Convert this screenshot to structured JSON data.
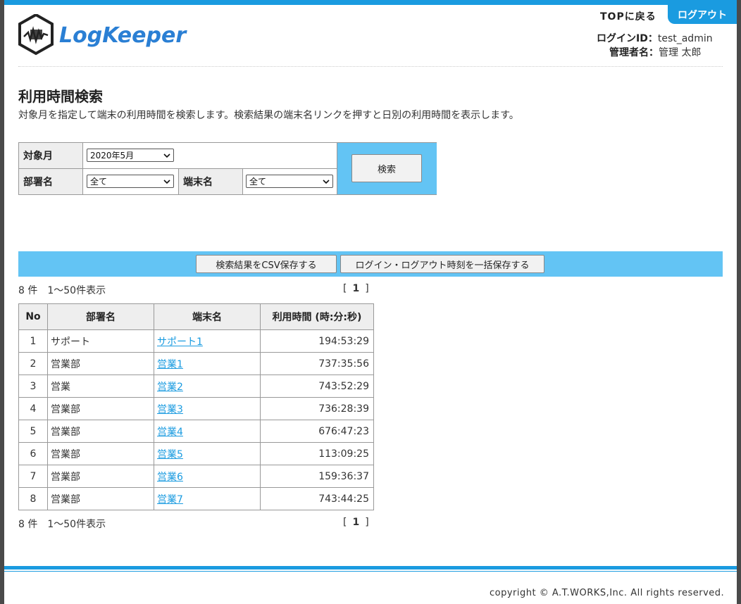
{
  "header": {
    "logo_text": "LogKeeper",
    "top_link": "TOPに戻る",
    "logout_label": "ログアウト",
    "login_id_label": "ログインID：",
    "login_id_value": "test_admin",
    "admin_name_label": "管理者名：",
    "admin_name_value": "管理 太郎"
  },
  "page": {
    "title": "利用時間検索",
    "description": "対象月を指定して端末の利用時間を検索します。検索結果の端末名リンクを押すと日別の利用時間を表示します。"
  },
  "search_form": {
    "month_label": "対象月",
    "month_value": "2020年5月",
    "dept_label": "部署名",
    "dept_value": "全て",
    "terminal_label": "端末名",
    "terminal_value": "全て",
    "search_button": "検索"
  },
  "actions": {
    "csv_button": "検索結果をCSV保存する",
    "bulk_save_button": "ログイン・ログアウト時刻を一括保存する"
  },
  "results": {
    "count_text": "8 件　1～50件表示",
    "pager_open": "[",
    "pager_page": "1",
    "pager_close": "]",
    "columns": [
      "No",
      "部署名",
      "端末名",
      "利用時間 (時:分:秒)"
    ],
    "rows": [
      {
        "no": "1",
        "dept": "サポート",
        "terminal": "サポート1",
        "time": "194:53:29"
      },
      {
        "no": "2",
        "dept": "営業部",
        "terminal": "営業1",
        "time": "737:35:56"
      },
      {
        "no": "3",
        "dept": "営業",
        "terminal": "営業2",
        "time": "743:52:29"
      },
      {
        "no": "4",
        "dept": "営業部",
        "terminal": "営業3",
        "time": "736:28:39"
      },
      {
        "no": "5",
        "dept": "営業部",
        "terminal": "営業4",
        "time": "676:47:23"
      },
      {
        "no": "6",
        "dept": "営業部",
        "terminal": "営業5",
        "time": "113:09:25"
      },
      {
        "no": "7",
        "dept": "営業部",
        "terminal": "営業6",
        "time": "159:36:37"
      },
      {
        "no": "8",
        "dept": "営業部",
        "terminal": "営業7",
        "time": "743:44:25"
      }
    ]
  },
  "footer": {
    "copyright": "copyright © A.T.WORKS,Inc. All rights reserved."
  },
  "colors": {
    "accent": "#1a9be0",
    "panel": "#63c4f4",
    "logo_blue": "#2a7fd4",
    "logo_dark": "#222222"
  }
}
